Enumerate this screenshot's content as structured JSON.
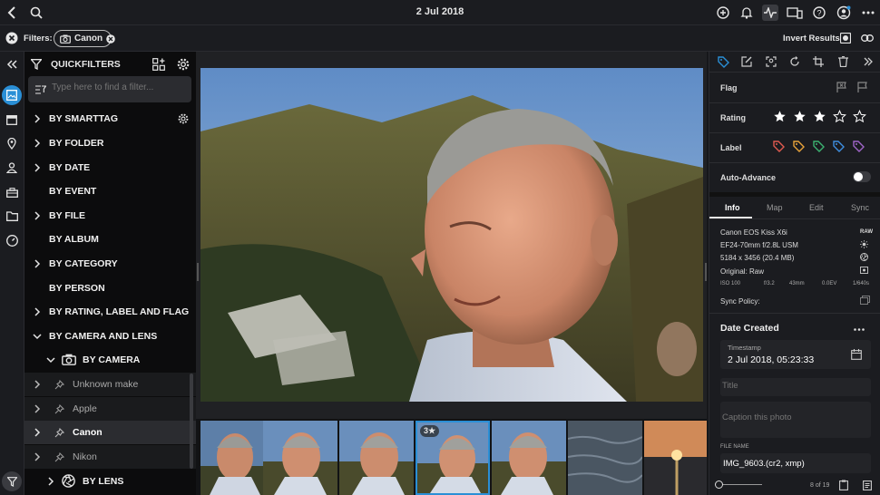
{
  "header": {
    "title": "2 Jul 2018"
  },
  "filters": {
    "label": "Filters:",
    "chip": "Canon",
    "invert_label": "Invert Results"
  },
  "quickfilters": {
    "title": "QUICKFILTERS",
    "search_placeholder": "Type here to find a filter...",
    "items": [
      {
        "label": "BY SMARTTAG"
      },
      {
        "label": "BY FOLDER"
      },
      {
        "label": "BY DATE"
      },
      {
        "label": "BY EVENT"
      },
      {
        "label": "BY FILE"
      },
      {
        "label": "BY ALBUM"
      },
      {
        "label": "BY CATEGORY"
      },
      {
        "label": "BY PERSON"
      },
      {
        "label": "BY RATING, LABEL AND FLAG"
      },
      {
        "label": "BY CAMERA AND LENS"
      },
      {
        "label": "BY CAMERA"
      },
      {
        "label": "Unknown make"
      },
      {
        "label": "Apple"
      },
      {
        "label": "Canon"
      },
      {
        "label": "Nikon"
      },
      {
        "label": "BY LENS"
      }
    ]
  },
  "filmstrip": {
    "badge": "3★"
  },
  "right": {
    "flag_label": "Flag",
    "rating_label": "Rating",
    "rating": 3,
    "rating_max": 5,
    "label_label": "Label",
    "label_colors": [
      "#e05a4f",
      "#e8a33a",
      "#3cb371",
      "#3e8ee0",
      "#a065c8"
    ],
    "autoadvance_label": "Auto-Advance",
    "tabs": [
      "Info",
      "Map",
      "Edit",
      "Sync"
    ],
    "camera": "Canon EOS Kiss X6i",
    "raw": "RAW",
    "lens": "EF24-70mm f/2.8L USM",
    "dimensions": "5184 x 3456 (20.4 MB)",
    "original": "Original: Raw",
    "exif": [
      "ISO 100",
      "f/3.2",
      "43mm",
      "0.0EV",
      "1/640s"
    ],
    "sync_policy": "Sync Policy:",
    "date_created": "Date Created",
    "timestamp_label": "Timestamp",
    "timestamp": "2 Jul 2018, 05:23:33",
    "title_placeholder": "Title",
    "caption_placeholder": "Caption this photo",
    "filename_label": "FILE NAME",
    "filename": "IMG_9603.(cr2, xmp)",
    "counter": "8 of 19"
  },
  "colors": {
    "accent": "#2a8fd6",
    "bg": "#16171a"
  }
}
